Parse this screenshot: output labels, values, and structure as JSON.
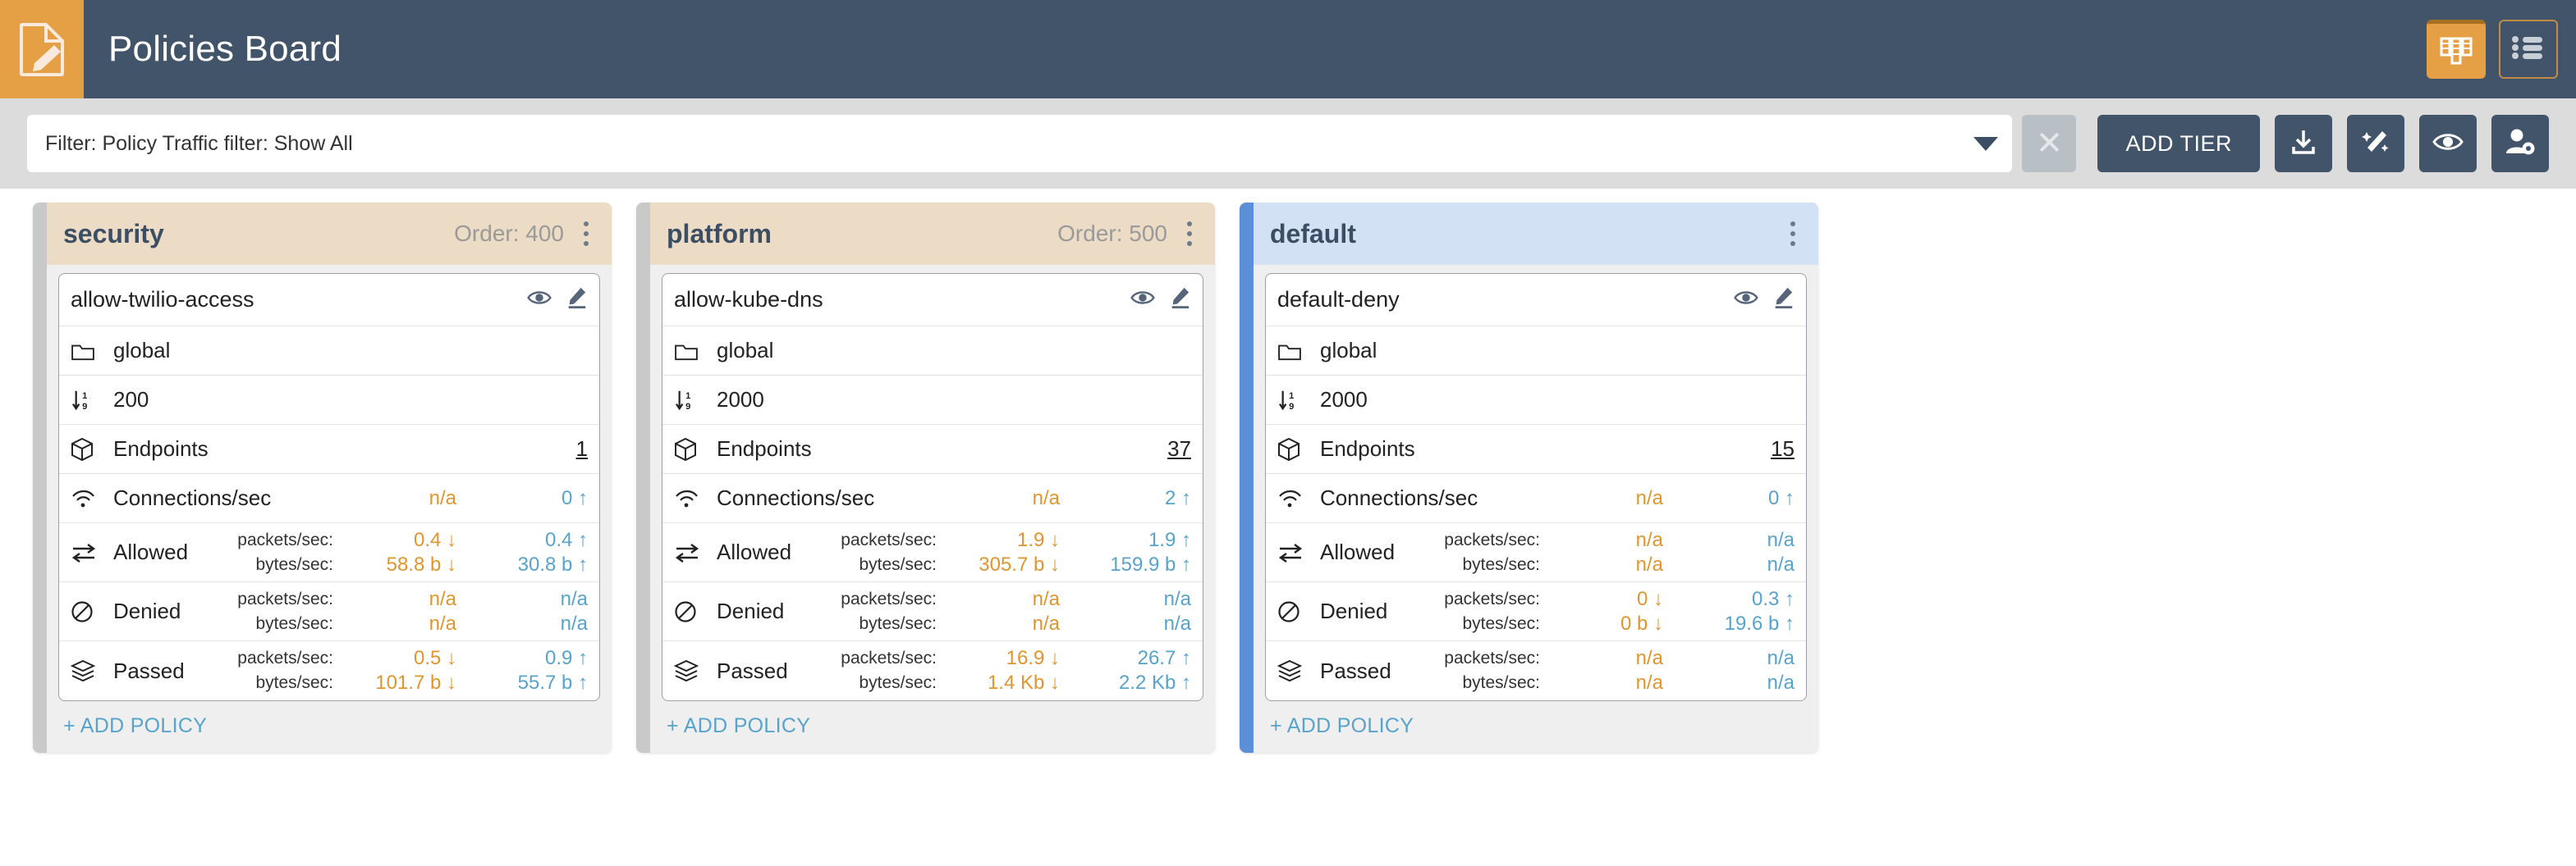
{
  "header": {
    "title": "Policies Board",
    "logo_icon": "document-edit-icon",
    "view_toggles": [
      {
        "name": "board-view",
        "icon": "board-columns-icon",
        "active": true
      },
      {
        "name": "list-view",
        "icon": "list-icon",
        "active": false
      }
    ]
  },
  "toolbar": {
    "filter_value": "Filter: Policy Traffic filter: Show All",
    "filter_placeholder": "Filter",
    "dropdown_icon": "chevron-down-icon",
    "clear_label": "✕",
    "add_tier_label": "ADD TIER",
    "actions": [
      {
        "name": "download-button",
        "icon": "download-icon"
      },
      {
        "name": "magic-wand-button",
        "icon": "magic-wand-icon"
      },
      {
        "name": "preview-button",
        "icon": "eye-icon"
      },
      {
        "name": "user-settings-button",
        "icon": "user-gear-icon"
      }
    ]
  },
  "colors": {
    "header_bg": "#42546a",
    "accent_orange": "#e59f45",
    "tier_security_accent": "#c9c9c9",
    "tier_platform_accent": "#c9c9c9",
    "tier_default_accent": "#5b8fd6",
    "tier_header_tan": "#ecdcc6",
    "tier_header_blue": "#d3e1f5",
    "value_ingress": "#e2952e",
    "value_egress": "#57a3cc",
    "link_blue": "#57a3cc"
  },
  "labels": {
    "add_policy": "+ ADD POLICY",
    "folder_icon": "folder-icon",
    "sort_icon": "sort-numeric-down-icon",
    "endpoints_icon": "cube-icon",
    "connections_icon": "wifi-icon",
    "allowed_icon": "arrows-exchange-icon",
    "denied_icon": "ban-icon",
    "passed_icon": "layers-icon",
    "eye_icon": "eye-icon",
    "edit_icon": "pencil-icon",
    "kebab_icon": "kebab-menu-icon",
    "packets_key": "packets/sec:",
    "bytes_key": "bytes/sec:",
    "endpoints_label": "Endpoints",
    "connections_label": "Connections/sec",
    "allowed_label": "Allowed",
    "denied_label": "Denied",
    "passed_label": "Passed"
  },
  "tiers": [
    {
      "name": "security",
      "order_label": "Order: 400",
      "accent": "#c9c9c9",
      "header_bg": "#ecdcc6",
      "policy": {
        "name": "allow-twilio-access",
        "scope": "global",
        "order": "200",
        "endpoints": "1",
        "connections": {
          "in": "n/a",
          "out": "0 ↑"
        },
        "allowed": {
          "packets_in": "0.4 ↓",
          "packets_out": "0.4 ↑",
          "bytes_in": "58.8 b ↓",
          "bytes_out": "30.8 b ↑"
        },
        "denied": {
          "packets_in": "n/a",
          "packets_out": "n/a",
          "bytes_in": "n/a",
          "bytes_out": "n/a"
        },
        "passed": {
          "packets_in": "0.5 ↓",
          "packets_out": "0.9 ↑",
          "bytes_in": "101.7 b ↓",
          "bytes_out": "55.7 b ↑"
        }
      }
    },
    {
      "name": "platform",
      "order_label": "Order: 500",
      "accent": "#c9c9c9",
      "header_bg": "#ecdcc6",
      "policy": {
        "name": "allow-kube-dns",
        "scope": "global",
        "order": "2000",
        "endpoints": "37",
        "connections": {
          "in": "n/a",
          "out": "2 ↑"
        },
        "allowed": {
          "packets_in": "1.9 ↓",
          "packets_out": "1.9 ↑",
          "bytes_in": "305.7 b ↓",
          "bytes_out": "159.9 b ↑"
        },
        "denied": {
          "packets_in": "n/a",
          "packets_out": "n/a",
          "bytes_in": "n/a",
          "bytes_out": "n/a"
        },
        "passed": {
          "packets_in": "16.9 ↓",
          "packets_out": "26.7 ↑",
          "bytes_in": "1.4 Kb ↓",
          "bytes_out": "2.2 Kb ↑"
        }
      }
    },
    {
      "name": "default",
      "order_label": "",
      "accent": "#5b8fd6",
      "header_bg": "#d3e1f5",
      "policy": {
        "name": "default-deny",
        "scope": "global",
        "order": "2000",
        "endpoints": "15",
        "connections": {
          "in": "n/a",
          "out": "0 ↑"
        },
        "allowed": {
          "packets_in": "n/a",
          "packets_out": "n/a",
          "bytes_in": "n/a",
          "bytes_out": "n/a"
        },
        "denied": {
          "packets_in": "0 ↓",
          "packets_out": "0.3 ↑",
          "bytes_in": "0 b ↓",
          "bytes_out": "19.6 b ↑"
        },
        "passed": {
          "packets_in": "n/a",
          "packets_out": "n/a",
          "bytes_in": "n/a",
          "bytes_out": "n/a"
        }
      }
    }
  ]
}
